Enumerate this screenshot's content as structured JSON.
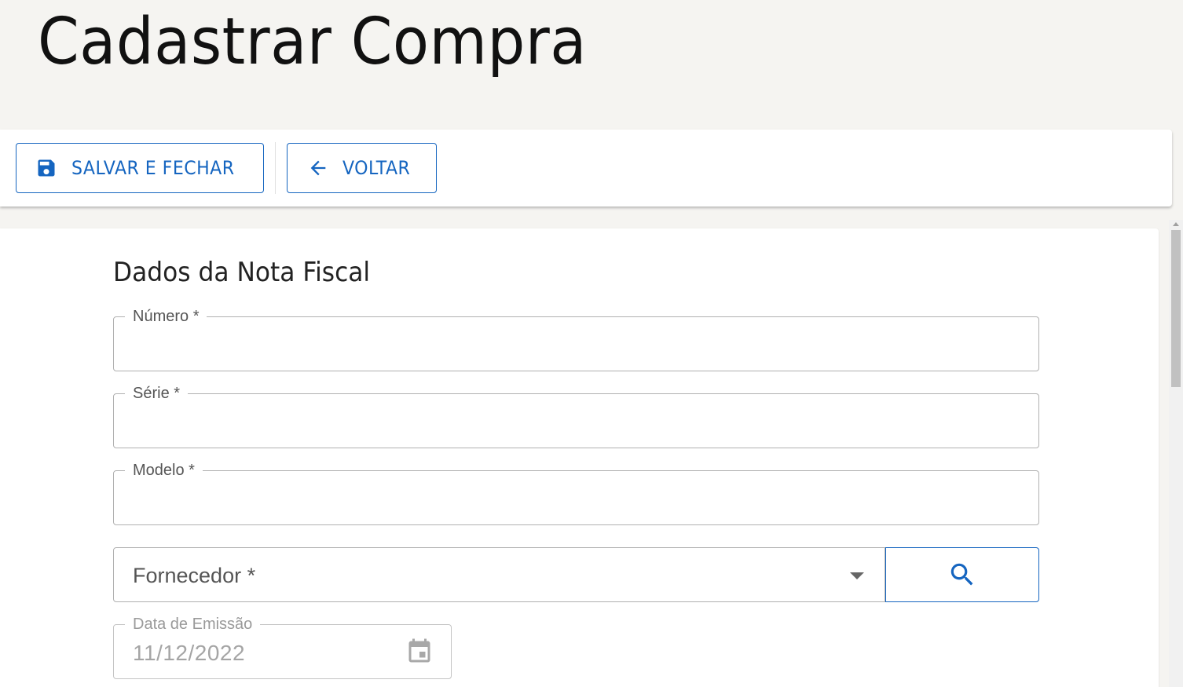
{
  "header": {
    "title": "Cadastrar Compra"
  },
  "toolbar": {
    "save_label": "SALVAR E FECHAR",
    "save_icon": "floppy-disk-icon",
    "back_label": "VOLTAR",
    "back_icon": "arrow-left-icon"
  },
  "form": {
    "section_title": "Dados da Nota Fiscal",
    "numero": {
      "label": "Número *",
      "value": ""
    },
    "serie": {
      "label": "Série *",
      "value": ""
    },
    "modelo": {
      "label": "Modelo *",
      "value": ""
    },
    "fornecedor": {
      "placeholder": "Fornecedor *",
      "selected": ""
    },
    "search_icon": "search-icon",
    "data_emissao": {
      "label": "Data de Emissão",
      "value": "11/12/2022"
    }
  },
  "colors": {
    "accent": "#1565c0",
    "page_background": "#f5f4f1",
    "surface": "#ffffff",
    "border": "#b0b0b0",
    "disabled_text": "#a5a5a5"
  }
}
